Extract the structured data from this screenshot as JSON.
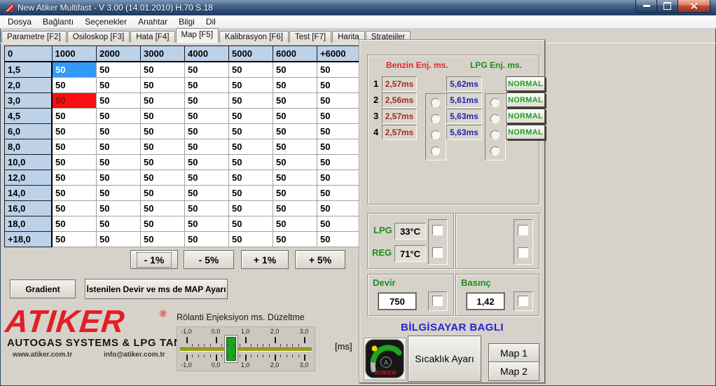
{
  "window": {
    "title": "New Atiker Multifast - V 3.00 (14.01.2010) H.70 S.18"
  },
  "menu": {
    "items": [
      {
        "id": "dosya",
        "label": "Dosya"
      },
      {
        "id": "baglanti",
        "label": "Bağlantı"
      },
      {
        "id": "secenekler",
        "label": "Seçenekler"
      },
      {
        "id": "anahtar",
        "label": "Anahtar"
      },
      {
        "id": "bilgi",
        "label": "Bilgi"
      },
      {
        "id": "dil",
        "label": "Dil"
      }
    ]
  },
  "tabs": [
    {
      "id": "parametre",
      "label": "Parametre [F2]",
      "active": false
    },
    {
      "id": "osiloskop",
      "label": "Osiloskop [F3]",
      "active": false
    },
    {
      "id": "hata",
      "label": "Hata [F4]",
      "active": false
    },
    {
      "id": "map",
      "label": "Map [F5]",
      "active": true
    },
    {
      "id": "kalibrasyon",
      "label": "Kalibrasyon [F6]",
      "active": false
    },
    {
      "id": "test",
      "label": "Test [F7]",
      "active": false
    },
    {
      "id": "harita",
      "label": "Harita",
      "active": false
    },
    {
      "id": "stratejiler",
      "label": "Stratejiler",
      "active": false
    }
  ],
  "map_table": {
    "col_headers": [
      "0",
      "1000",
      "2000",
      "3000",
      "4000",
      "5000",
      "6000",
      "+6000"
    ],
    "row_labels": [
      "1,5",
      "2,0",
      "3,0",
      "4,5",
      "6,0",
      "8,0",
      "10,0",
      "12,0",
      "14,0",
      "16,0",
      "18,0",
      "+18,0"
    ],
    "fill_value": "50",
    "selected_cell": {
      "row": 0,
      "col": 0
    },
    "alarm_cell": {
      "row": 2,
      "col": 0
    }
  },
  "adjust_buttons": [
    {
      "id": "minus-1-percent",
      "label": "- 1%",
      "focused": true
    },
    {
      "id": "minus-5-percent",
      "label": "- 5%",
      "focused": false
    },
    {
      "id": "plus-1-percent",
      "label": "+ 1%",
      "focused": false
    },
    {
      "id": "plus-5-percent",
      "label": "+ 5%",
      "focused": false
    }
  ],
  "tools": {
    "gradient_label": "Gradient",
    "map_adjust_label": "İstenilen Devir ve ms de MAP Ayarı"
  },
  "branding": {
    "logo_text": "ATIKER",
    "registered_mark": "®",
    "tagline": "AUTOGAS SYSTEMS & LPG TANKS",
    "website": "www.atiker.com.tr",
    "email": "info@atiker.com.tr"
  },
  "idle_correction": {
    "label": "Rölanti Enjeksiyon ms. Düzeltme",
    "unit": "[ms]",
    "tick_labels": [
      "-1,0",
      "0,0",
      "1,0",
      "2,0",
      "3,0"
    ],
    "min": -1,
    "max": 3,
    "value": 0.5
  },
  "injection_monitor": {
    "benzin_header": "Benzin Enj. ms.",
    "lpg_header": "LPG Enj. ms.",
    "rows": [
      {
        "num": "1",
        "benzin": "2,57ms",
        "lpg": "5,62ms",
        "status": "NORMAL"
      },
      {
        "num": "2",
        "benzin": "2,56ms",
        "lpg": "5,61ms",
        "status": "NORMAL"
      },
      {
        "num": "3",
        "benzin": "2,57ms",
        "lpg": "5,63ms",
        "status": "NORMAL"
      },
      {
        "num": "4",
        "benzin": "2,57ms",
        "lpg": "5,63ms",
        "status": "NORMAL"
      }
    ]
  },
  "temperatures": {
    "lpg_label": "LPG",
    "lpg_value": "33°C",
    "reg_label": "REG",
    "reg_value": "71°C"
  },
  "rpm": {
    "label": "Devir",
    "value": "750"
  },
  "pressure": {
    "label": "Basınç",
    "value": "1,42"
  },
  "status": {
    "connection": "BİLGİSAYAR BAGLI"
  },
  "bottom_buttons": {
    "temperature_setting": "Sıcaklık Ayarı",
    "map1": "Map 1",
    "map2": "Map 2"
  },
  "colors": {
    "selected-cell": "#3398fc",
    "alarm-cell": "#fb0d10",
    "alarm-text": "#7a1a10",
    "benzin-text": "#a03028",
    "lpg-text": "#2525b0",
    "normal-green": "#1fa01f",
    "label-green": "#1e8e1e",
    "status-blue": "#2323d6",
    "logo-red": "#e21f26",
    "header-blue": "#bdd2e8"
  }
}
